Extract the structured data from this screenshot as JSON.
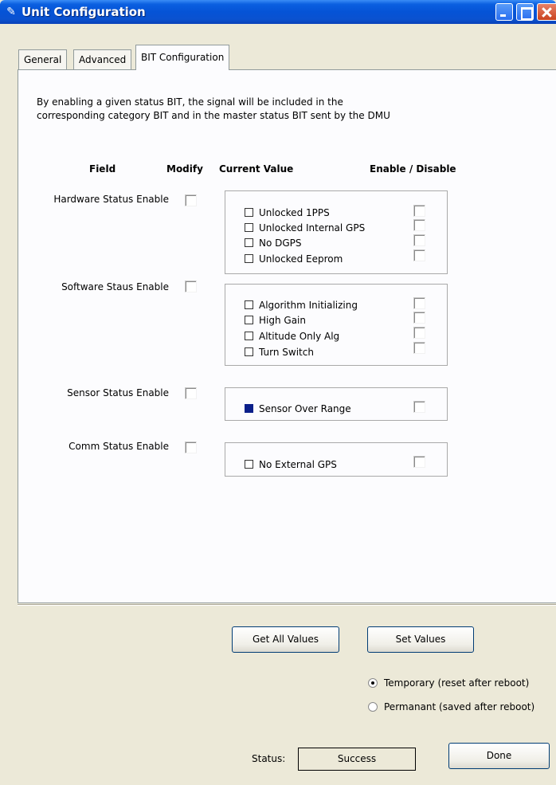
{
  "window": {
    "title": "Unit Configuration",
    "icon": "pen-icon",
    "controls": [
      "minimize",
      "maximize",
      "close"
    ]
  },
  "tabs": [
    {
      "label": "General",
      "active": false
    },
    {
      "label": "Advanced",
      "active": false
    },
    {
      "label": "BIT Configuration",
      "active": true
    }
  ],
  "description": {
    "line1": "By enabling a given status BIT,  the signal will be included in the",
    "line2": "corresponding category BIT and in the  master status BIT sent by the DMU"
  },
  "columns": {
    "field": "Field",
    "modify": "Modify",
    "current_value": "Current Value",
    "enable_disable": "Enable / Disable"
  },
  "rows": [
    {
      "label": "Hardware Status Enable",
      "modify": false,
      "items": [
        {
          "label": "Unlocked 1PPS",
          "value": false,
          "enabled": false
        },
        {
          "label": "Unlocked Internal GPS",
          "value": false,
          "enabled": false
        },
        {
          "label": "No DGPS",
          "value": false,
          "enabled": false
        },
        {
          "label": "Unlocked Eeprom",
          "value": false,
          "enabled": false
        }
      ]
    },
    {
      "label": "Software Staus Enable",
      "modify": false,
      "items": [
        {
          "label": "Algorithm Initializing",
          "value": false,
          "enabled": false
        },
        {
          "label": "High Gain",
          "value": false,
          "enabled": false
        },
        {
          "label": "Altitude Only Alg",
          "value": false,
          "enabled": false
        },
        {
          "label": "Turn Switch",
          "value": false,
          "enabled": false
        }
      ]
    },
    {
      "label": "Sensor Status Enable",
      "modify": false,
      "items": [
        {
          "label": "Sensor Over Range",
          "value": true,
          "enabled": false
        }
      ]
    },
    {
      "label": "Comm Status Enable",
      "modify": false,
      "items": [
        {
          "label": "No External GPS",
          "value": false,
          "enabled": false
        }
      ]
    }
  ],
  "buttons": {
    "get_all": "Get All Values",
    "set": "Set Values",
    "done": "Done"
  },
  "persistence": {
    "temporary": "Temporary (reset after reboot)",
    "permanent": "Permanant (saved after reboot)",
    "selected": "temporary"
  },
  "status": {
    "label": "Status:",
    "value": "Success"
  },
  "colors": {
    "titlebar": "#0553d6",
    "dialog_bg": "#ece9d8",
    "panel_bg": "#fcfcfe",
    "indicator_on": "#0a1f8a"
  }
}
